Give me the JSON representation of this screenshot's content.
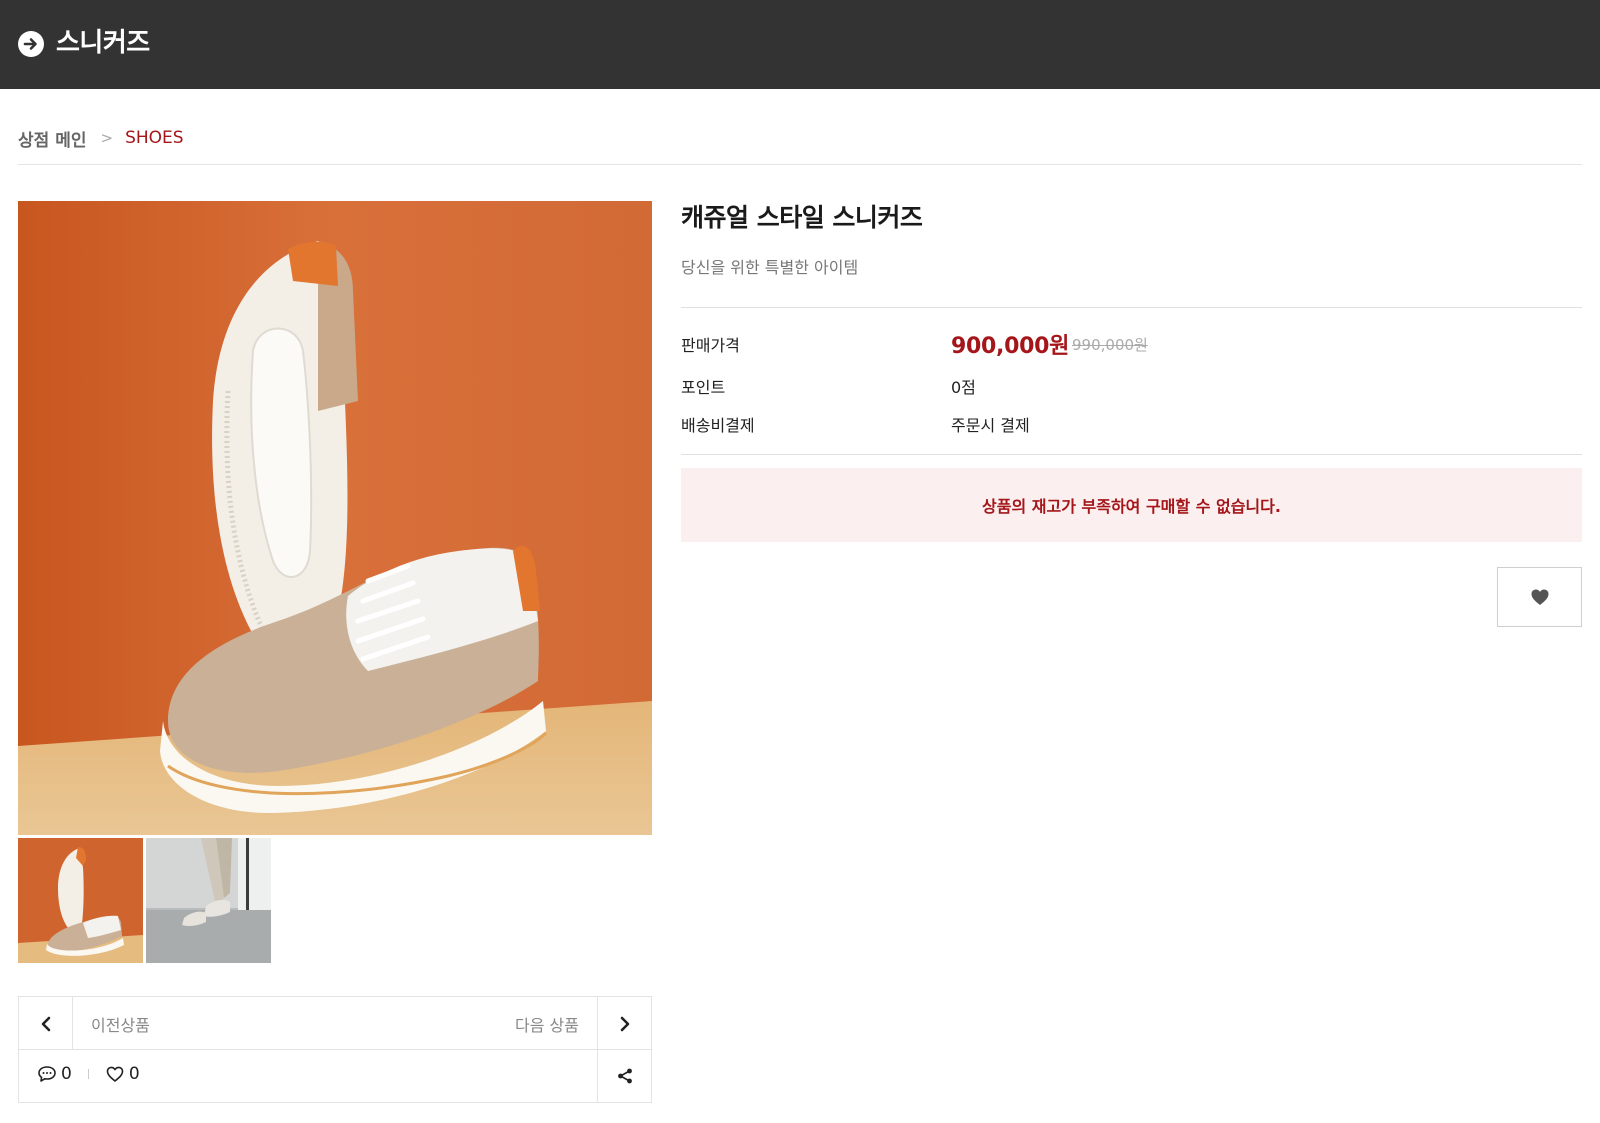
{
  "header": {
    "title": "스니커즈",
    "back_icon": "arrow-right-circle-icon"
  },
  "breadcrumb": {
    "home": "상점 메인",
    "separator": ">",
    "current": "SHOES"
  },
  "gallery": {
    "main_image": "sneaker-sole-and-side-on-orange-background",
    "thumbnails": [
      "sneaker-orange-background-thumb",
      "person-wearing-sneakers-thumb"
    ]
  },
  "navigation": {
    "prev_label": "이전상품",
    "next_label": "다음 상품",
    "comment_count": "0",
    "like_count": "0",
    "icons": {
      "prev": "chevron-left-icon",
      "next": "chevron-right-icon",
      "comment": "comment-bubble-icon",
      "like": "heart-outline-icon",
      "share": "share-icon"
    }
  },
  "product": {
    "title": "캐쥬얼 스타일 스니커즈",
    "subtitle": "당신을 위한 특별한 아이템",
    "price_label": "판매가격",
    "price_sale": "900,000원",
    "price_original": "990,000원",
    "point_label": "포인트",
    "point_value": "0점",
    "shipping_label": "배송비결제",
    "shipping_value": "주문시 결제",
    "soldout_message": "상품의 재고가 부족하여 구매할 수 없습니다.",
    "wish_icon": "heart-filled-icon"
  },
  "colors": {
    "header_bg": "#333333",
    "accent": "#a4161a",
    "soldout_bg": "#fcefef"
  }
}
